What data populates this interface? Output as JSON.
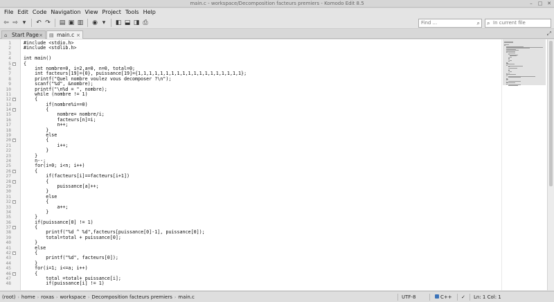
{
  "window": {
    "title": "main.c - workspace/Decomposition facteurs premiers - Komodo Edit 8.5"
  },
  "menu": [
    "File",
    "Edit",
    "Code",
    "Navigation",
    "View",
    "Project",
    "Tools",
    "Help"
  ],
  "toolbar": {
    "find_placeholder": "Find ...",
    "scope_placeholder": "In current file"
  },
  "tabs": [
    {
      "label": "Start Page",
      "active": false
    },
    {
      "label": "main.c",
      "active": true
    }
  ],
  "editor": {
    "lines": [
      {
        "n": "1",
        "text": "#include <stdio.h>"
      },
      {
        "n": "2",
        "text": "#include <stdlib.h>"
      },
      {
        "n": "3",
        "text": ""
      },
      {
        "n": "4",
        "text": "int main()"
      },
      {
        "n": "5",
        "text": "{",
        "fold": "-"
      },
      {
        "n": "6",
        "text": "    int nombre=0, i=2,a=0, n=0, total=0;"
      },
      {
        "n": "7",
        "text": "    int facteurs[19]={0}, puissance[19]={1,1,1,1,1,1,1,1,1,1,1,1,1,1,1,1,1,1,1};"
      },
      {
        "n": "8",
        "text": "    printf(\"Quel nombre voulez vous decomposer ?\\n\");"
      },
      {
        "n": "9",
        "text": "    scanf(\"%d\", &nombre);"
      },
      {
        "n": "10",
        "text": "    printf(\"\\n%d = \", nombre);"
      },
      {
        "n": "11",
        "text": "    while (nombre != 1)"
      },
      {
        "n": "12",
        "text": "    {",
        "fold": "-"
      },
      {
        "n": "13",
        "text": "        if(nombre%i==0)"
      },
      {
        "n": "14",
        "text": "        {",
        "fold": "-"
      },
      {
        "n": "15",
        "text": "            nombre= nombre/i;"
      },
      {
        "n": "16",
        "text": "            facteurs[n]=i;"
      },
      {
        "n": "17",
        "text": "            n++;"
      },
      {
        "n": "18",
        "text": "        }"
      },
      {
        "n": "19",
        "text": "        else"
      },
      {
        "n": "20",
        "text": "        {",
        "fold": "-"
      },
      {
        "n": "21",
        "text": "            i++;"
      },
      {
        "n": "22",
        "text": "        }"
      },
      {
        "n": "23",
        "text": "    }"
      },
      {
        "n": "24",
        "text": "    n--;"
      },
      {
        "n": "25",
        "text": "    for(i=0; i<n; i++)"
      },
      {
        "n": "26",
        "text": "    {",
        "fold": "-"
      },
      {
        "n": "27",
        "text": "        if(facteurs[i]==facteurs[i+1])"
      },
      {
        "n": "28",
        "text": "        {",
        "fold": "-"
      },
      {
        "n": "29",
        "text": "            puissance[a]++;"
      },
      {
        "n": "30",
        "text": "        }"
      },
      {
        "n": "31",
        "text": "        else"
      },
      {
        "n": "32",
        "text": "        {",
        "fold": "-"
      },
      {
        "n": "33",
        "text": "            a++;"
      },
      {
        "n": "34",
        "text": "        }"
      },
      {
        "n": "35",
        "text": "    }"
      },
      {
        "n": "36",
        "text": "    if(puissance[0] != 1)"
      },
      {
        "n": "37",
        "text": "    {",
        "fold": "-"
      },
      {
        "n": "38",
        "text": "        printf(\"%d ^ %d\",facteurs[puissance[0]-1], puissance[0]);"
      },
      {
        "n": "39",
        "text": "        total=total + puissance[0];"
      },
      {
        "n": "40",
        "text": "    }"
      },
      {
        "n": "41",
        "text": "    else"
      },
      {
        "n": "42",
        "text": "    {",
        "fold": "-"
      },
      {
        "n": "43",
        "text": "        printf(\"%d\", facteurs[0]);"
      },
      {
        "n": "44",
        "text": "    }"
      },
      {
        "n": "45",
        "text": "    for(i=1; i<=a; i++)"
      },
      {
        "n": "46",
        "text": "    {",
        "fold": "-"
      },
      {
        "n": "47",
        "text": "        total =total+ puissance[i];"
      },
      {
        "n": "48",
        "text": "        if(puissance[i] != 1)"
      }
    ]
  },
  "statusbar": {
    "breadcrumb": [
      "(root)",
      "home",
      "roxas",
      "workspace",
      "Decomposition facteurs premiers",
      "main.c"
    ],
    "encoding": "UTF-8",
    "language": "C++",
    "position": "Ln: 1 Col: 1"
  }
}
